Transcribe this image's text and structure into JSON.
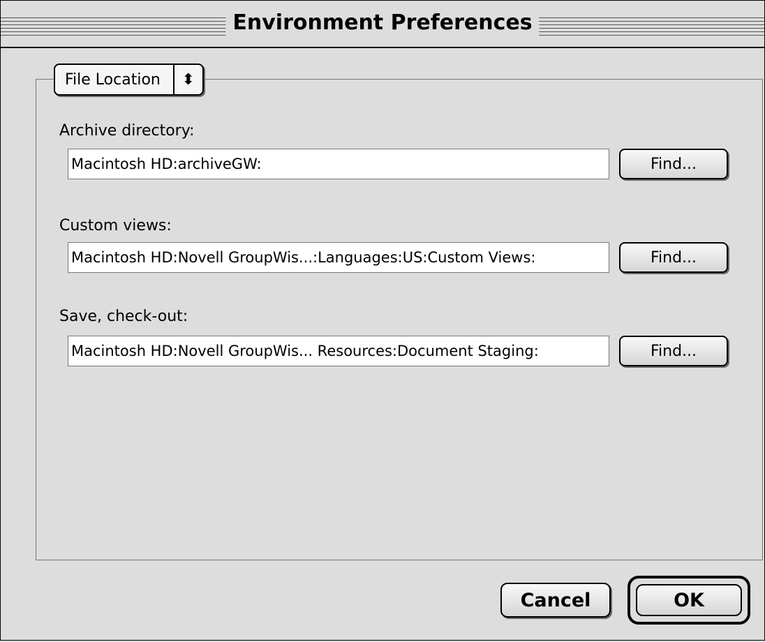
{
  "window": {
    "title": "Environment Preferences"
  },
  "popup": {
    "selected": "File Location",
    "arrows": "⬍"
  },
  "fields": [
    {
      "label": "Archive directory:",
      "value": "Macintosh HD:archiveGW:",
      "button": "Find..."
    },
    {
      "label": "Custom views:",
      "value": "Macintosh HD:Novell GroupWis...:Languages:US:Custom Views:",
      "button": "Find..."
    },
    {
      "label": "Save, check-out:",
      "value": "Macintosh HD:Novell GroupWis... Resources:Document Staging:",
      "button": "Find..."
    }
  ],
  "buttons": {
    "cancel": "Cancel",
    "ok": "OK"
  }
}
